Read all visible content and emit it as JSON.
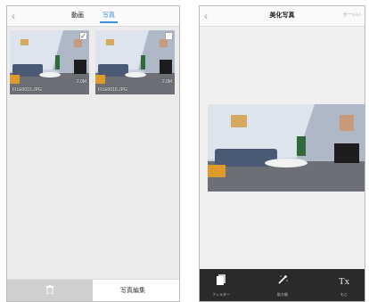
{
  "left": {
    "tabs": [
      {
        "label": "動画"
      },
      {
        "label": "写真"
      }
    ],
    "photos": [
      {
        "filename": "FILE0015.JPG",
        "size": "2.0M"
      },
      {
        "filename": "FILE0016.JPG",
        "size": "2.0M"
      }
    ],
    "edit_label": "写真編集"
  },
  "right": {
    "title": "美化写真",
    "cancel": "かーいい",
    "tools": [
      {
        "label": "フィルター",
        "icon": "filter-icon"
      },
      {
        "label": "貼り紙",
        "icon": "sticker-wand-icon"
      },
      {
        "label": "もじ",
        "icon": "text-icon"
      }
    ]
  },
  "colors": {
    "accent": "#3a8fe0",
    "toolbar": "#2a2a2a"
  }
}
